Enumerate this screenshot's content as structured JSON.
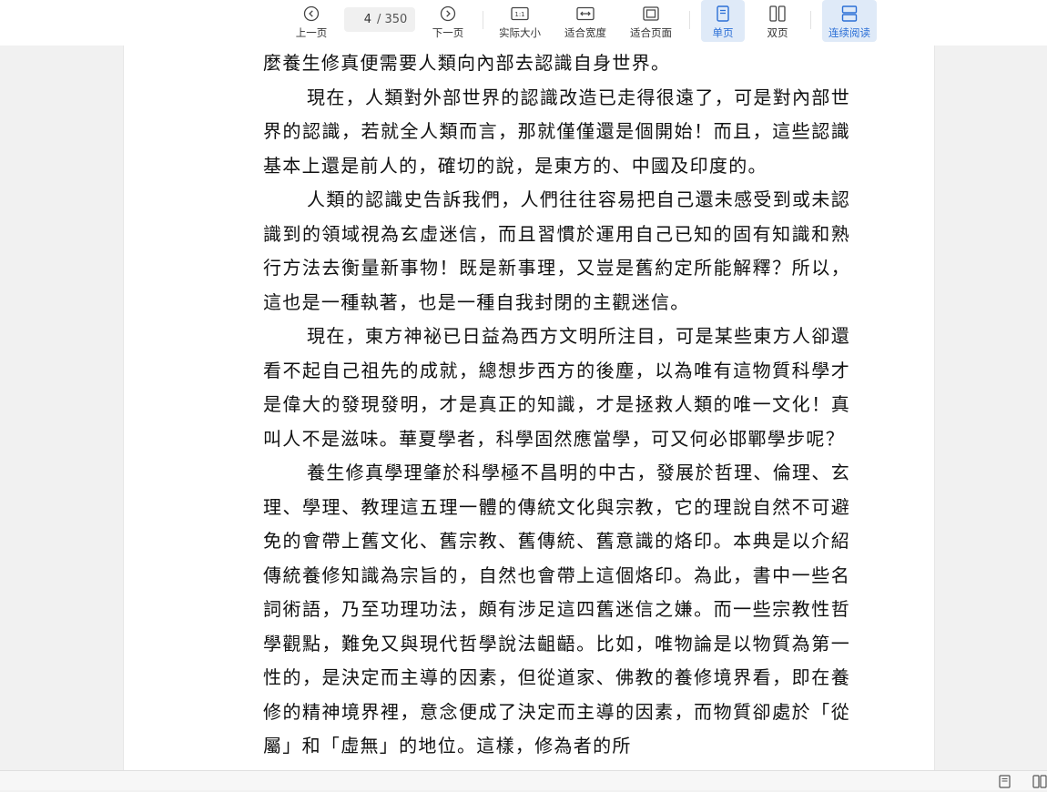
{
  "toolbar": {
    "prev_label": "上一页",
    "page_current": "4",
    "page_total": "/ 350",
    "next_label": "下一页",
    "actual_size_label": "实际大小",
    "fit_width_label": "适合宽度",
    "fit_page_label": "适合页面",
    "single_page_label": "单页",
    "double_page_label": "双页",
    "continuous_label": "连续阅读",
    "active_color": "#2b6fd6"
  },
  "document": {
    "paragraphs": [
      "麼養生修真便需要人類向內部去認識自身世界。",
      "現在，人類對外部世界的認識改造已走得很遠了，可是對內部世界的認識，若就全人類而言，那就僅僅還是個開始！而且，這些認識基本上還是前人的，確切的說，是東方的、中國及印度的。",
      "人類的認識史告訴我們，人們往往容易把自己還未感受到或未認識到的領域視為玄虛迷信，而且習慣於運用自己已知的固有知識和熟行方法去衡量新事物！既是新事理，又豈是舊約定所能解釋？所以，這也是一種執著，也是一種自我封閉的主觀迷信。",
      "現在，東方神祕已日益為西方文明所注目，可是某些東方人卻還看不起自己祖先的成就，總想步西方的後塵，以為唯有這物質科學才是偉大的發現發明，才是真正的知識，才是拯救人類的唯一文化！真叫人不是滋味。華夏學者，科學固然應當學，可又何必邯鄲學步呢？",
      "養生修真學理肇於科學極不昌明的中古，發展於哲理、倫理、玄理、學理、教理這五理一體的傳統文化與宗教，它的理說自然不可避免的會帶上舊文化、舊宗教、舊傳統、舊意識的烙印。本典是以介紹傳統養修知識為宗旨的，自然也會帶上這個烙印。為此，書中一些名詞術語，乃至功理功法，頗有涉足這四舊迷信之嫌。而一些宗教性哲學觀點，難免又與現代哲學說法齟齬。比如，唯物論是以物質為第一性的，是決定而主導的因素，但從道家、佛教的養修境界看，即在養修的精神境界裡，意念便成了決定而主導的因素，而物質卻處於「從屬」和「虛無」的地位。這樣，修為者的所"
    ]
  }
}
